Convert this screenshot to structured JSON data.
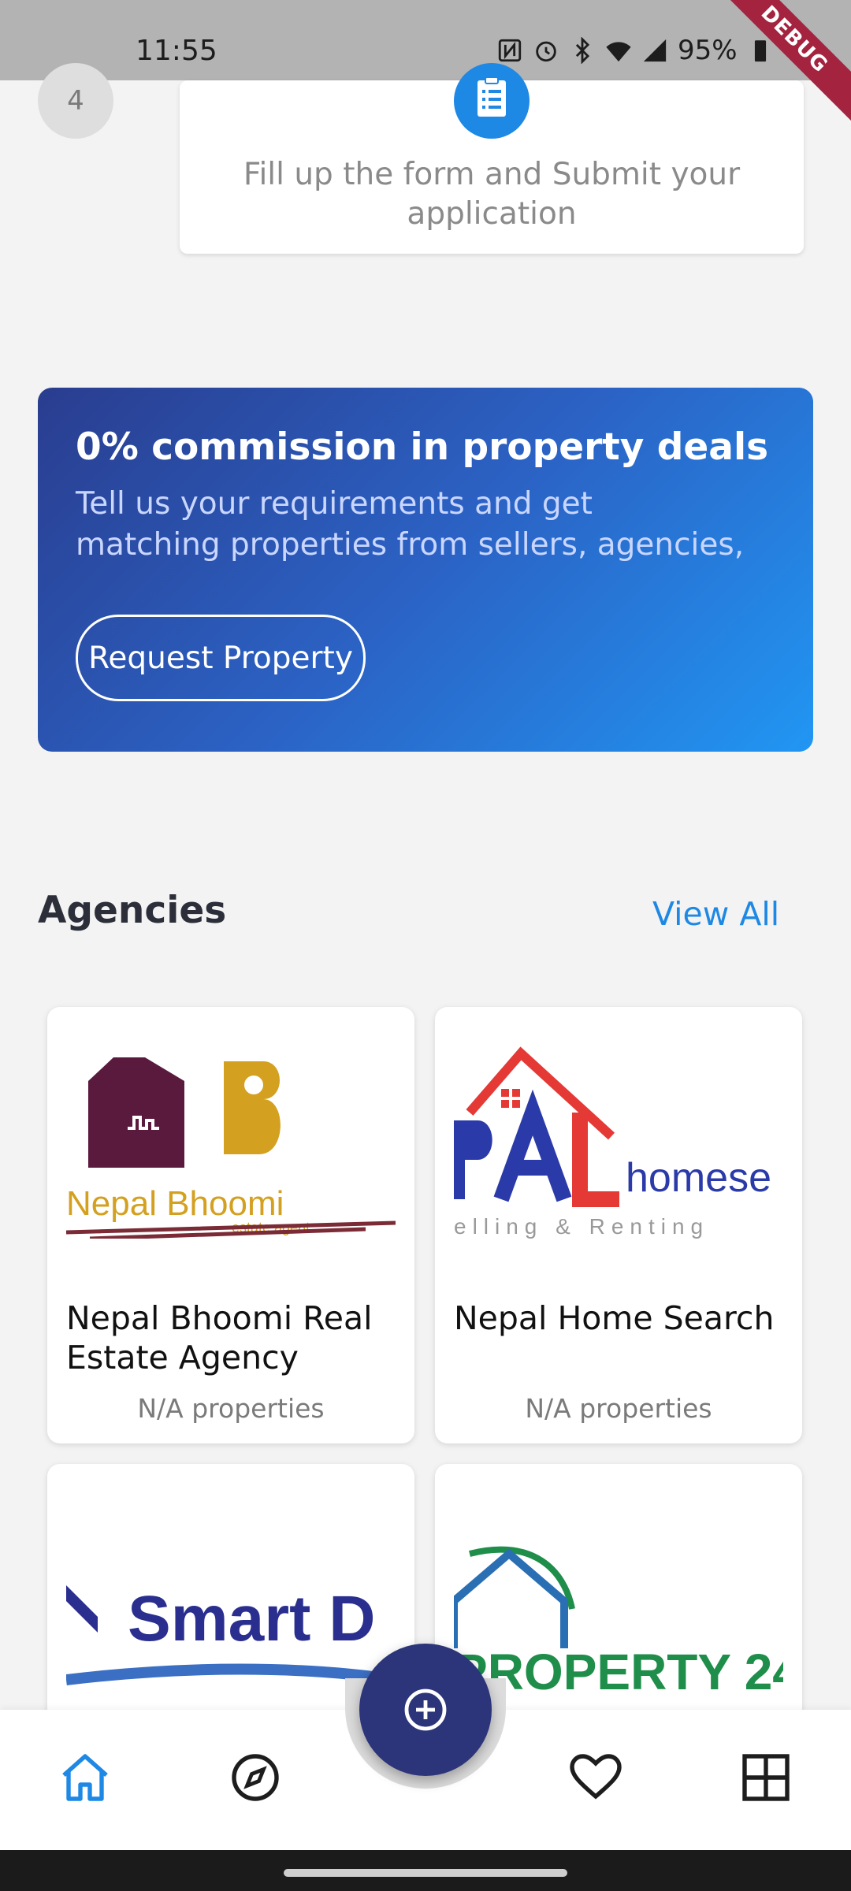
{
  "status_bar": {
    "time": "11:55",
    "battery": "95%",
    "debug_label": "DEBUG"
  },
  "step": {
    "number": "4",
    "text": "Fill up the form and Submit your application"
  },
  "promo": {
    "title": "0% commission in property deals",
    "subtitle_line1": "Tell us your requirements and get",
    "subtitle_line2": "matching properties from sellers, agencies,",
    "button_label": "Request Property"
  },
  "agencies": {
    "title": "Agencies",
    "view_all": "View All",
    "items": [
      {
        "name": "Nepal Bhoomi Real Estate Agency",
        "count": "N/A properties",
        "logo_text": "Nepal Bhoomi",
        "logo_sub": "estate agent"
      },
      {
        "name": "Nepal Home Search",
        "count": "N/A properties",
        "logo_text": "homese",
        "logo_sub": "elling & Renting"
      },
      {
        "name": "",
        "count": "",
        "logo_text": "Smart D"
      },
      {
        "name": "",
        "count": "",
        "logo_text": "PROPERTY 24"
      }
    ]
  },
  "bottom_nav": {
    "items": [
      {
        "icon": "home-icon",
        "active": true
      },
      {
        "icon": "compass-icon",
        "active": false
      },
      {
        "icon": "heart-icon",
        "active": false
      },
      {
        "icon": "grid-icon",
        "active": false
      }
    ],
    "fab_icon": "add-circle-icon"
  },
  "colors": {
    "accent": "#1e88e5",
    "fab": "#2c347a",
    "promo_start": "#2a3d8f",
    "promo_end": "#2196f3"
  }
}
